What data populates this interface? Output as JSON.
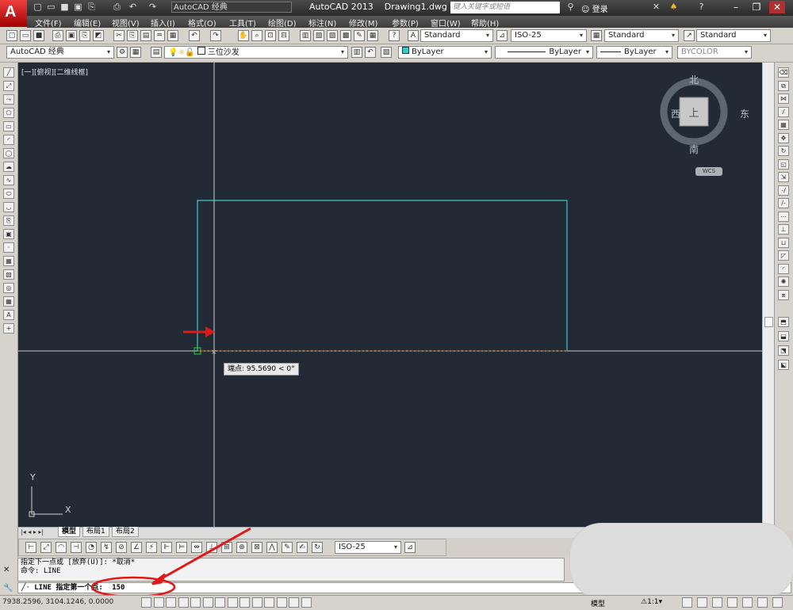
{
  "window": {
    "app_title": "AutoCAD 2013",
    "file_name": "Drawing1.dwg",
    "workspace": "AutoCAD 经典",
    "search_placeholder": "键入关键字或短语",
    "login_label": "登录"
  },
  "menu": [
    "文件(F)",
    "编辑(E)",
    "视图(V)",
    "插入(I)",
    "格式(O)",
    "工具(T)",
    "绘图(D)",
    "标注(N)",
    "修改(M)",
    "参数(P)",
    "窗口(W)",
    "帮助(H)"
  ],
  "styles": {
    "text_style": "Standard",
    "dim_style": "ISO-25",
    "table_style": "Standard",
    "multileader_style": "Standard"
  },
  "workspace_combo": "AutoCAD 经典",
  "layer_combo": "三位沙发",
  "properties": {
    "color": "ByLayer",
    "linetype": "ByLayer",
    "lineweight": "ByLayer",
    "plotstyle": "BYCOLOR"
  },
  "viewport": {
    "label": "[一][俯视][二维线框]",
    "tooltip": "端点: 95.5690 < 0°"
  },
  "viewcube": {
    "north": "北",
    "south": "南",
    "east": "东",
    "west": "西",
    "top": "上",
    "wcs": "WCS"
  },
  "ucs": {
    "x": "X",
    "y": "Y"
  },
  "tabs": [
    "模型",
    "布局1",
    "布局2"
  ],
  "dim_style_combo": "ISO-25",
  "command": {
    "history": [
      "指定下一点或 [放弃(U)]: *取消*",
      "命令:  LINE"
    ],
    "prompt": "LINE 指定第一个点:",
    "input": "150"
  },
  "status": {
    "coordinates": "7938.2596,  3104.1246,  0.0000",
    "model_label": "模型",
    "scale": "1:1"
  },
  "colors": {
    "canvas": "#222b35",
    "drawing_line": "#3ec8c8",
    "annotation_red": "#e01818"
  }
}
